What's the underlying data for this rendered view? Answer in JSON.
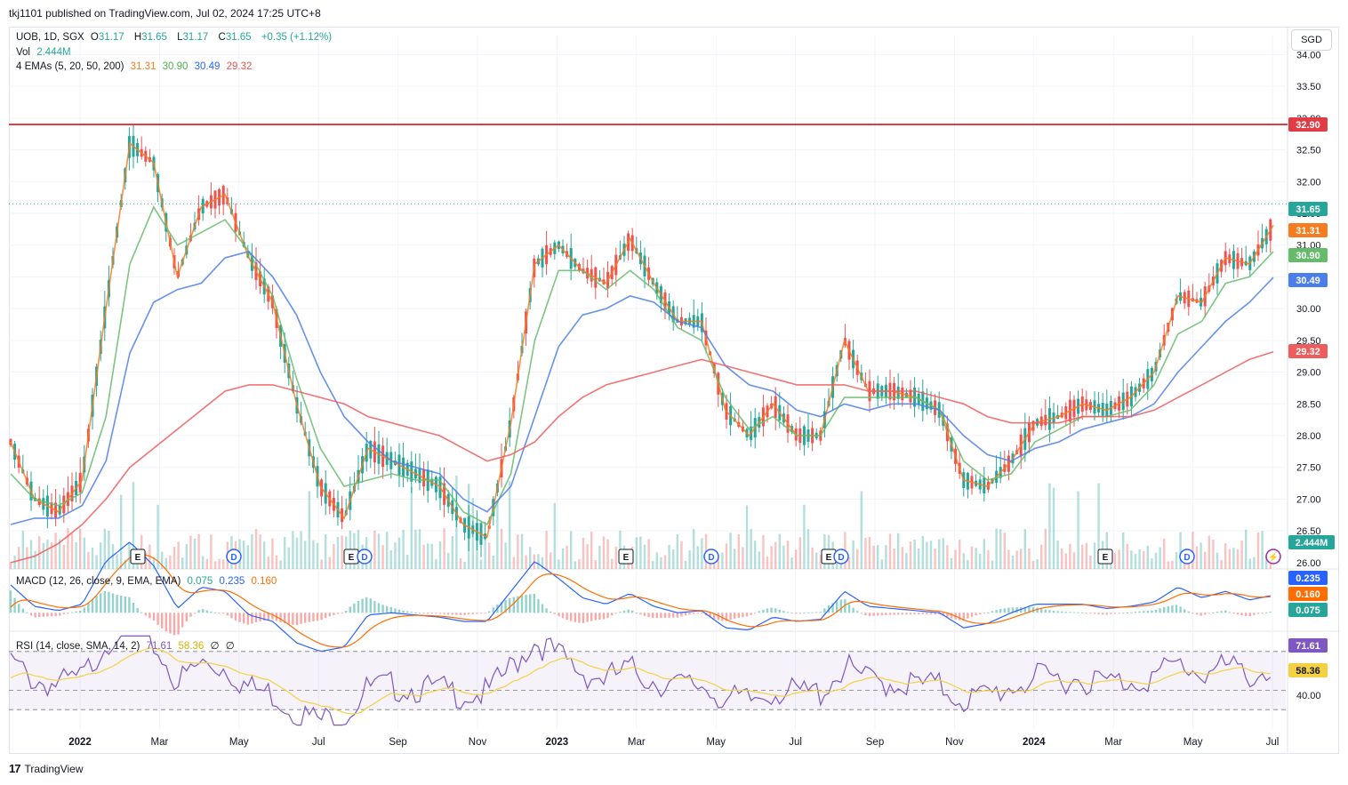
{
  "header": {
    "published": "tkj1101 published on TradingView.com, Jul 02, 2024 17:25 UTC+8"
  },
  "currency_button": "SGD",
  "legend": {
    "symbol": "UOB, 1D, SGX",
    "o_label": "O",
    "o_value": "31.17",
    "h_label": "H",
    "h_value": "31.65",
    "l_label": "L",
    "l_value": "31.17",
    "c_label": "C",
    "c_value": "31.65",
    "change": "+0.35 (+1.12%)",
    "vol_label": "Vol",
    "vol_value": "2.444M",
    "ema_label": "4 EMAs (5, 20, 50, 200)",
    "ema5": "31.31",
    "ema20": "30.90",
    "ema50": "30.49",
    "ema200": "29.32",
    "macd_label": "MACD (12, 26, close, 9, EMA, EMA)",
    "macd_hist": "0.075",
    "macd_line": "0.235",
    "macd_signal": "0.160",
    "rsi_label": "RSI (14, close, SMA, 14, 2)",
    "rsi_value": "71.61",
    "rsi_ma": "58.36",
    "rsi_extra1": "∅",
    "rsi_extra2": "∅"
  },
  "footer": {
    "brand": "TradingView"
  },
  "colors": {
    "up": "#26a69a",
    "down": "#ef5350",
    "ema5": "#f57c1f",
    "ema20": "#66bb6a",
    "ema50": "#4c7ee8",
    "ema200": "#ef5c5c",
    "resistance": "#e03c45",
    "macd_line": "#2962ff",
    "macd_signal": "#ff6d00",
    "rsi": "#7e57c2",
    "rsi_ma": "#f5d142"
  },
  "chart_data": {
    "type": "line",
    "title": "UOB, 1D, SGX",
    "ylim": [
      25.9,
      34.3
    ],
    "y_ticks": [
      "34.00",
      "33.50",
      "33.00",
      "32.50",
      "32.00",
      "31.50",
      "31.00",
      "30.50",
      "30.00",
      "29.50",
      "29.00",
      "28.50",
      "28.00",
      "27.50",
      "27.00",
      "26.50",
      "26.00"
    ],
    "x_ticks": [
      "2022",
      "Mar",
      "May",
      "Jul",
      "Sep",
      "Nov",
      "2023",
      "Mar",
      "May",
      "Jul",
      "Sep",
      "Nov",
      "2024",
      "Mar",
      "May",
      "Jul"
    ],
    "resistance_level": 32.9,
    "resistance_label": "32.90",
    "last_price_label": "31.65",
    "price_tags": [
      "31.65",
      "31.31",
      "30.90",
      "30.49",
      "29.32"
    ],
    "volume_tag": "2.444M",
    "events": [
      "E",
      "D",
      "E",
      "D",
      "E",
      "D",
      "E",
      "D",
      "E",
      "D"
    ],
    "series": [
      {
        "name": "EMA 5",
        "values": [
          27.9,
          27.0,
          26.8,
          27.3,
          30.0,
          32.6,
          32.3,
          30.5,
          31.6,
          31.8,
          30.8,
          30.1,
          28.5,
          27.2,
          26.7,
          27.8,
          27.6,
          27.4,
          27.2,
          26.6,
          26.4,
          28.2,
          30.7,
          31.0,
          30.6,
          30.4,
          31.1,
          30.4,
          29.8,
          29.8,
          28.4,
          28.0,
          28.5,
          28.0,
          28.0,
          29.5,
          28.7,
          28.7,
          28.6,
          28.4,
          27.3,
          27.2,
          27.6,
          28.2,
          28.3,
          28.5,
          28.4,
          28.6,
          29.0,
          30.2,
          30.1,
          30.8,
          30.7,
          31.31
        ]
      },
      {
        "name": "EMA 20",
        "values": [
          27.4,
          27.0,
          26.9,
          27.1,
          28.3,
          30.7,
          31.6,
          31.0,
          31.2,
          31.4,
          30.9,
          30.2,
          28.9,
          27.8,
          27.2,
          27.3,
          27.4,
          27.3,
          27.3,
          26.8,
          26.6,
          27.4,
          29.5,
          30.6,
          30.6,
          30.3,
          30.6,
          30.3,
          29.7,
          29.5,
          28.6,
          28.1,
          28.3,
          28.0,
          28.0,
          28.6,
          28.6,
          28.6,
          28.6,
          28.4,
          27.6,
          27.3,
          27.4,
          27.9,
          28.1,
          28.3,
          28.3,
          28.4,
          28.8,
          29.6,
          29.8,
          30.4,
          30.5,
          30.9
        ]
      },
      {
        "name": "EMA 50",
        "values": [
          26.6,
          26.7,
          26.7,
          26.9,
          27.6,
          29.3,
          30.1,
          30.3,
          30.4,
          30.8,
          30.9,
          30.5,
          29.9,
          29.0,
          28.3,
          27.9,
          27.6,
          27.5,
          27.4,
          27.0,
          26.8,
          27.2,
          28.3,
          29.4,
          29.9,
          30.0,
          30.2,
          30.1,
          29.8,
          29.7,
          29.1,
          28.8,
          28.7,
          28.4,
          28.3,
          28.5,
          28.4,
          28.5,
          28.5,
          28.4,
          28.0,
          27.7,
          27.6,
          27.8,
          27.9,
          28.1,
          28.2,
          28.3,
          28.5,
          29.0,
          29.4,
          29.8,
          30.1,
          30.49
        ]
      },
      {
        "name": "EMA 200",
        "values": [
          26.0,
          26.1,
          26.3,
          26.6,
          27.0,
          27.5,
          27.8,
          28.1,
          28.4,
          28.7,
          28.8,
          28.8,
          28.7,
          28.6,
          28.5,
          28.3,
          28.2,
          28.1,
          28.0,
          27.8,
          27.6,
          27.7,
          27.9,
          28.3,
          28.6,
          28.8,
          28.9,
          29.0,
          29.1,
          29.2,
          29.1,
          29.0,
          28.9,
          28.8,
          28.8,
          28.8,
          28.7,
          28.7,
          28.7,
          28.6,
          28.5,
          28.3,
          28.2,
          28.2,
          28.2,
          28.3,
          28.3,
          28.3,
          28.4,
          28.6,
          28.8,
          29.0,
          29.2,
          29.32
        ]
      }
    ],
    "macd_ylim": [
      -0.3,
      0.7
    ],
    "rsi_ylim": [
      30,
      80
    ],
    "rsi_levels": [
      70,
      50,
      40
    ],
    "rsi_tick_label": "40.00"
  }
}
